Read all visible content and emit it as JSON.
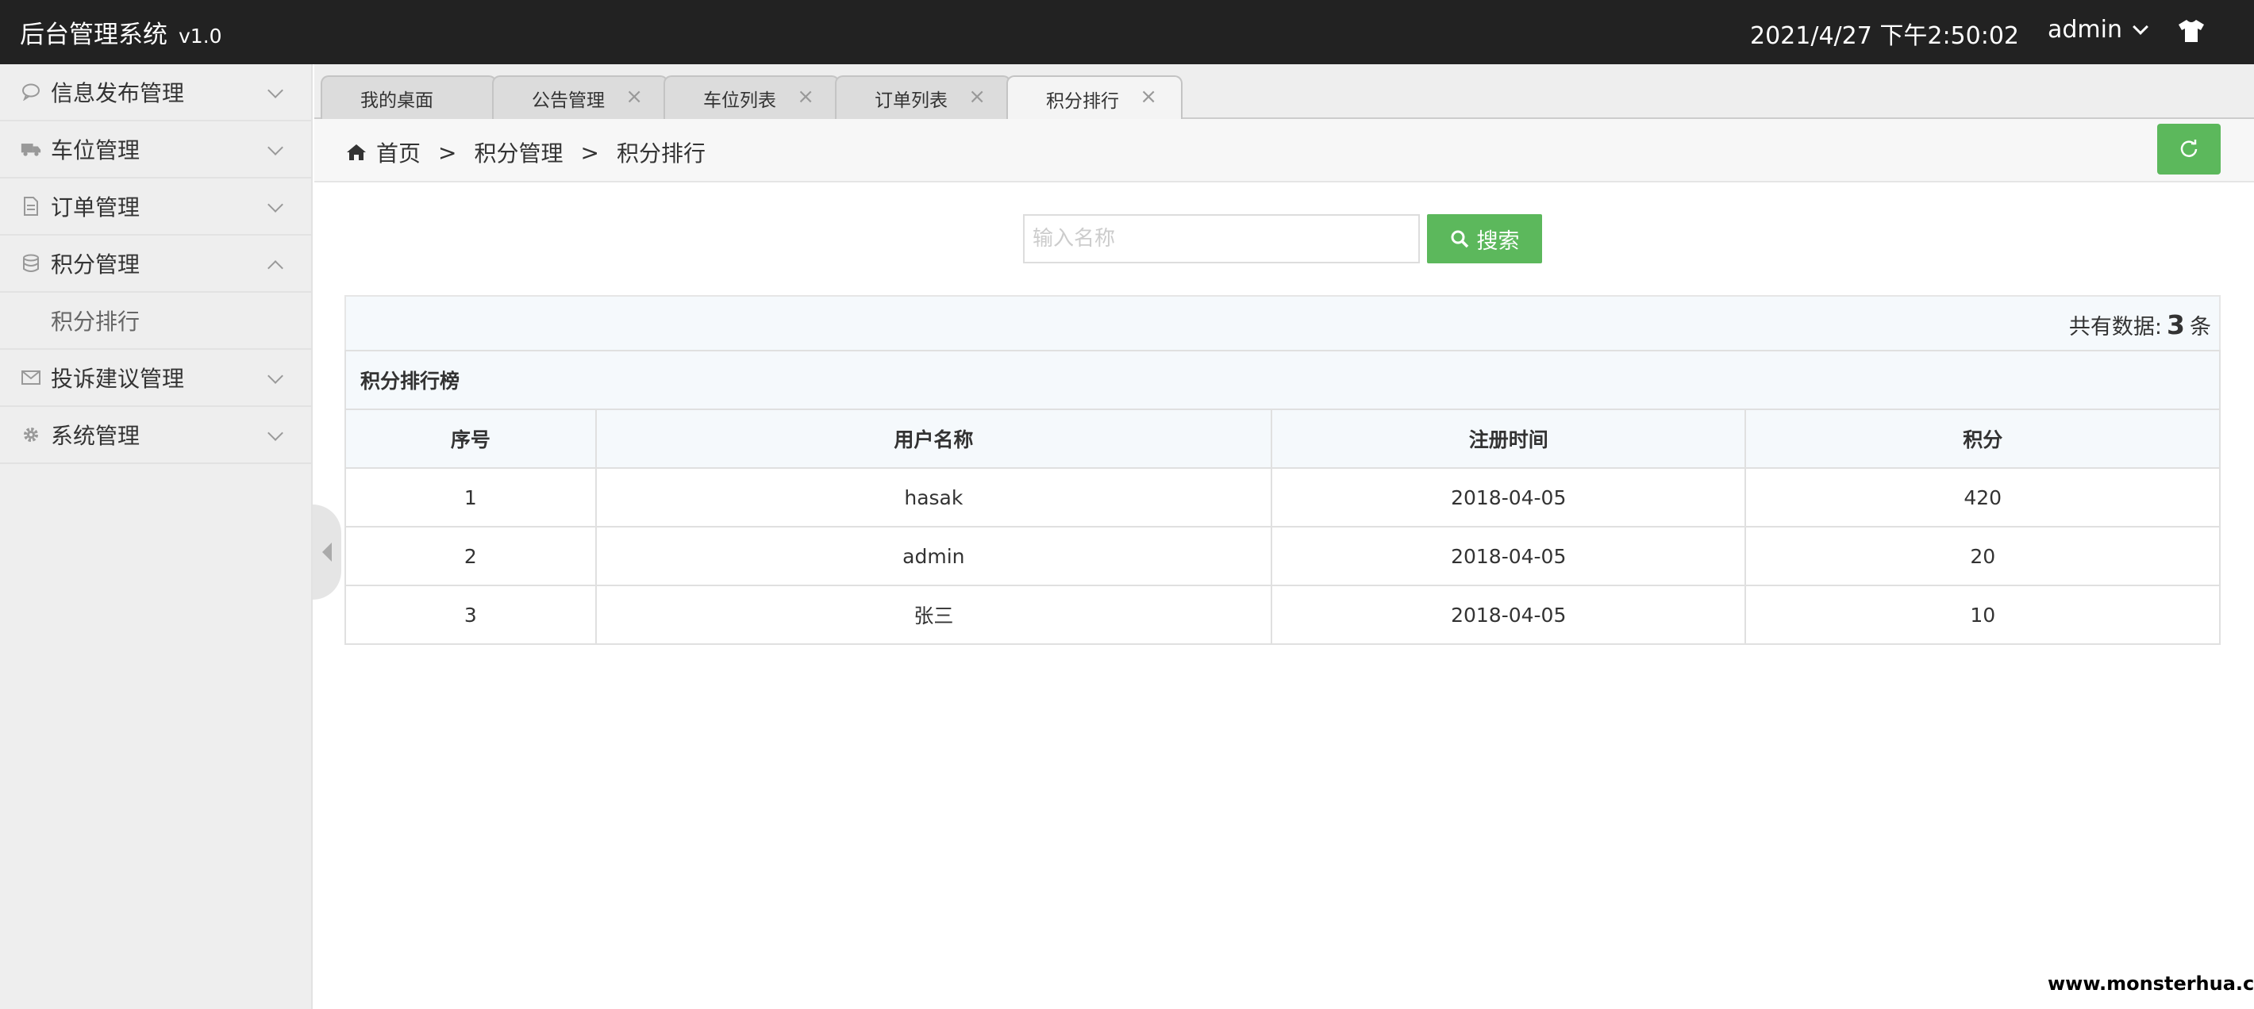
{
  "header": {
    "app_title": "后台管理系统",
    "version": "v1.0",
    "datetime": "2021/4/27 下午2:50:02",
    "user": "admin",
    "theme_icon": "tshirt-icon"
  },
  "sidebar": {
    "items": [
      {
        "label": "信息发布管理",
        "icon": "comment-icon"
      },
      {
        "label": "车位管理",
        "icon": "truck-icon"
      },
      {
        "label": "订单管理",
        "icon": "file-icon"
      },
      {
        "label": "积分管理",
        "icon": "database-icon",
        "expanded": true
      },
      {
        "label": "投诉建议管理",
        "icon": "envelope-icon"
      },
      {
        "label": "系统管理",
        "icon": "gear-icon"
      }
    ],
    "sub_items": [
      {
        "label": "积分排行"
      }
    ]
  },
  "tabs": [
    {
      "label": "我的桌面",
      "closable": false
    },
    {
      "label": "公告管理",
      "closable": true
    },
    {
      "label": "车位列表",
      "closable": true
    },
    {
      "label": "订单列表",
      "closable": true
    },
    {
      "label": "积分排行",
      "closable": true,
      "active": true
    }
  ],
  "close_glyph": "×",
  "breadcrumb": {
    "items": [
      "首页",
      "积分管理",
      "积分排行"
    ],
    "separator": ">"
  },
  "search": {
    "placeholder": "输入名称",
    "button_label": "搜索"
  },
  "summary": {
    "prefix": "共有数据:",
    "count": "3",
    "suffix": "条"
  },
  "table": {
    "caption": "积分排行榜",
    "columns": [
      "序号",
      "用户名称",
      "注册时间",
      "积分"
    ],
    "rows": [
      [
        "1",
        "hasak",
        "2018-04-05",
        "420"
      ],
      [
        "2",
        "admin",
        "2018-04-05",
        "20"
      ],
      [
        "3",
        "张三",
        "2018-04-05",
        "10"
      ]
    ]
  },
  "watermark": "www.monsterhua.com",
  "colors": {
    "header_bg": "#222222",
    "accent_green": "#5cb85c",
    "sidebar_bg": "#eeeeee"
  }
}
